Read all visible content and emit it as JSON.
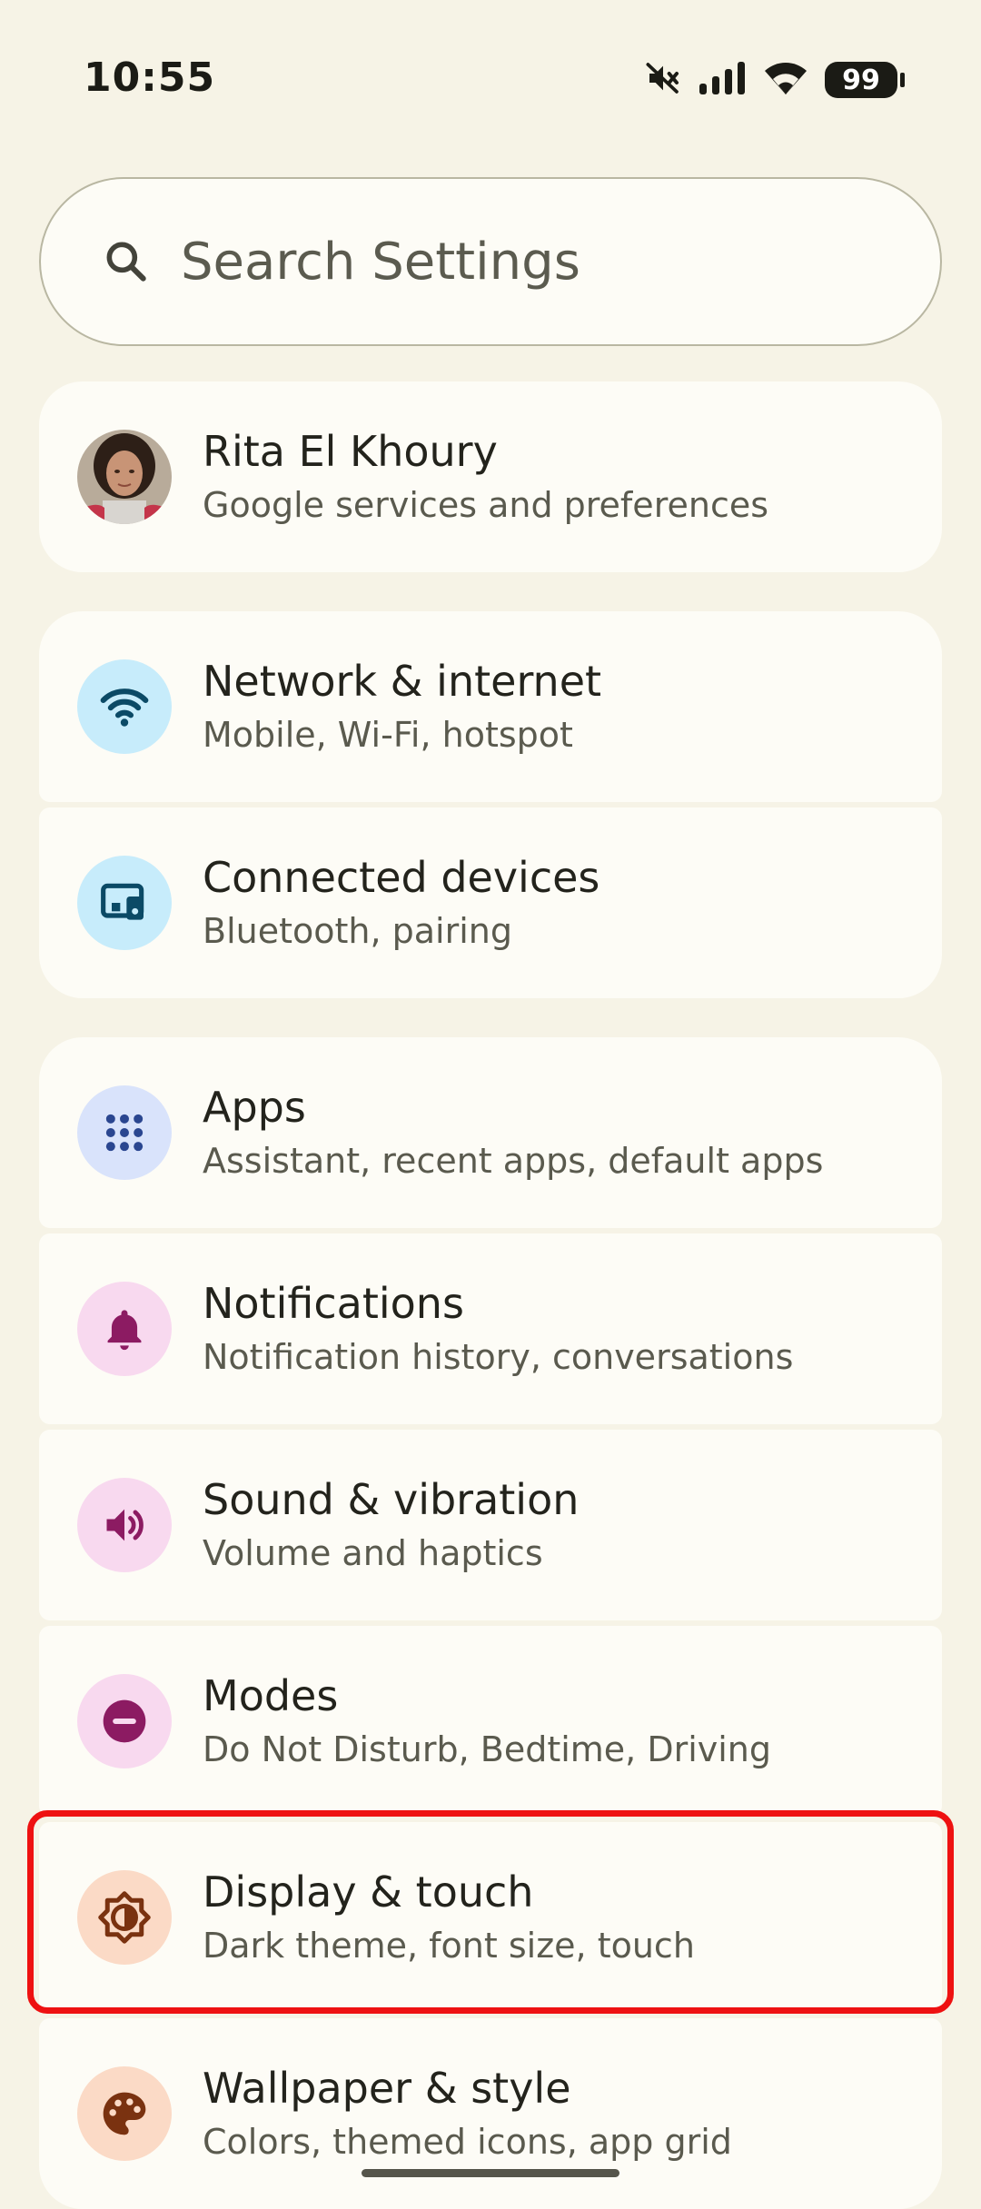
{
  "status_bar": {
    "time": "10:55",
    "battery": "99",
    "icons": [
      "mute-icon",
      "signal-icon",
      "wifi-icon",
      "battery-icon"
    ]
  },
  "search": {
    "placeholder": "Search Settings",
    "icon": "search-icon"
  },
  "account": {
    "name": "Rita El Khoury",
    "subtitle": "Google services and preferences"
  },
  "settings": [
    {
      "title": "Network & internet",
      "subtitle": "Mobile, Wi-Fi, hotspot",
      "icon": "wifi-icon",
      "bg": "#c7ecfb",
      "fg": "#0b4a66"
    },
    {
      "title": "Connected devices",
      "subtitle": "Bluetooth, pairing",
      "icon": "devices-icon",
      "bg": "#c7ecfb",
      "fg": "#0b4a66"
    },
    {
      "title": "Apps",
      "subtitle": "Assistant, recent apps, default apps",
      "icon": "apps-grid-icon",
      "bg": "#d9e3fb",
      "fg": "#2a4690"
    },
    {
      "title": "Notifications",
      "subtitle": "Notification history, conversations",
      "icon": "bell-icon",
      "bg": "#f8d9ef",
      "fg": "#8c1b62"
    },
    {
      "title": "Sound & vibration",
      "subtitle": "Volume and haptics",
      "icon": "speaker-icon",
      "bg": "#f8d9ef",
      "fg": "#8c1b62"
    },
    {
      "title": "Modes",
      "subtitle": "Do Not Disturb, Bedtime, Driving",
      "icon": "do-not-disturb-icon",
      "bg": "#f8d9ef",
      "fg": "#8c1b62"
    },
    {
      "title": "Display & touch",
      "subtitle": "Dark theme, font size, touch",
      "icon": "brightness-icon",
      "bg": "#fbdac6",
      "fg": "#7a3210"
    },
    {
      "title": "Wallpaper & style",
      "subtitle": "Colors, themed icons, app grid",
      "icon": "palette-icon",
      "bg": "#fbdac6",
      "fg": "#7a3210"
    }
  ],
  "colors": {
    "background": "#f6f3e6",
    "card": "#fdfcf6",
    "highlight": "#ee1111"
  }
}
